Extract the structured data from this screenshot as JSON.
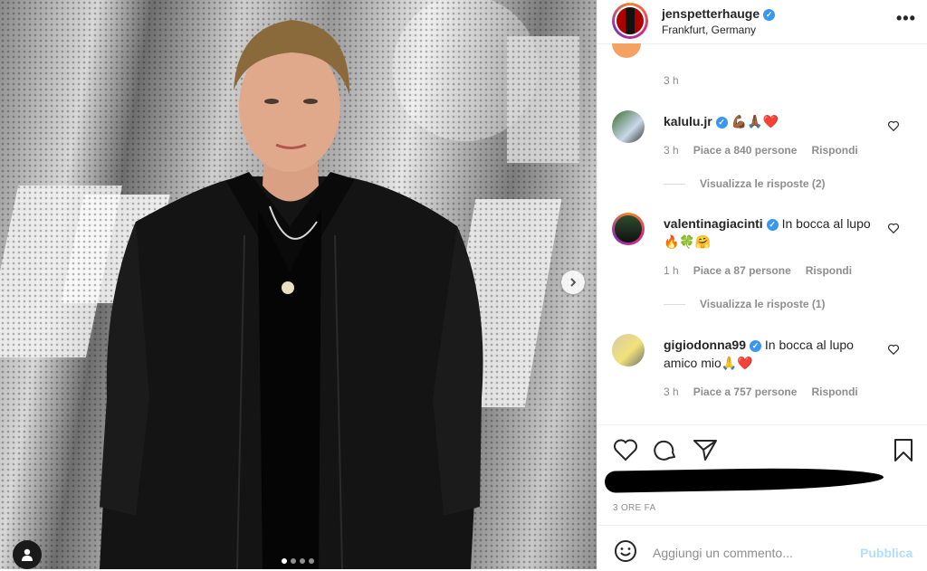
{
  "post": {
    "username": "jenspetterhauge",
    "location": "Frankfurt, Germany",
    "more_icon": "more-horizontal-icon",
    "next_icon": "chevron-right-icon",
    "carousel_dots": 4,
    "carousel_active": 1
  },
  "feed": {
    "prev_time": "3 h"
  },
  "comments": [
    {
      "username": "kalulu.jr",
      "verified": true,
      "text": "💪🏾🙏🏾❤️",
      "time": "3 h",
      "likes": "Piace a 840 persone",
      "reply": "Rispondi",
      "view_replies": "Visualizza le risposte (2)"
    },
    {
      "username": "valentinagiacinti",
      "verified": true,
      "text": "In bocca al lupo 🔥🍀🤗",
      "time": "1 h",
      "likes": "Piace a 87 persone",
      "reply": "Rispondi",
      "view_replies": "Visualizza le risposte (1)"
    },
    {
      "username": "gigiodonna99",
      "verified": true,
      "text": "In bocca al lupo amico mio🙏❤️",
      "time": "3 h",
      "likes": "Piace a 757 persone",
      "reply": "Rispondi"
    }
  ],
  "footer": {
    "time_ago": "3 ORE FA",
    "comment_placeholder": "Aggiungi un commento...",
    "post_button": "Pubblica"
  },
  "colors": {
    "accent": "#3897f0",
    "muted": "#8e8e8e",
    "post_disabled": "#b2dffc"
  }
}
